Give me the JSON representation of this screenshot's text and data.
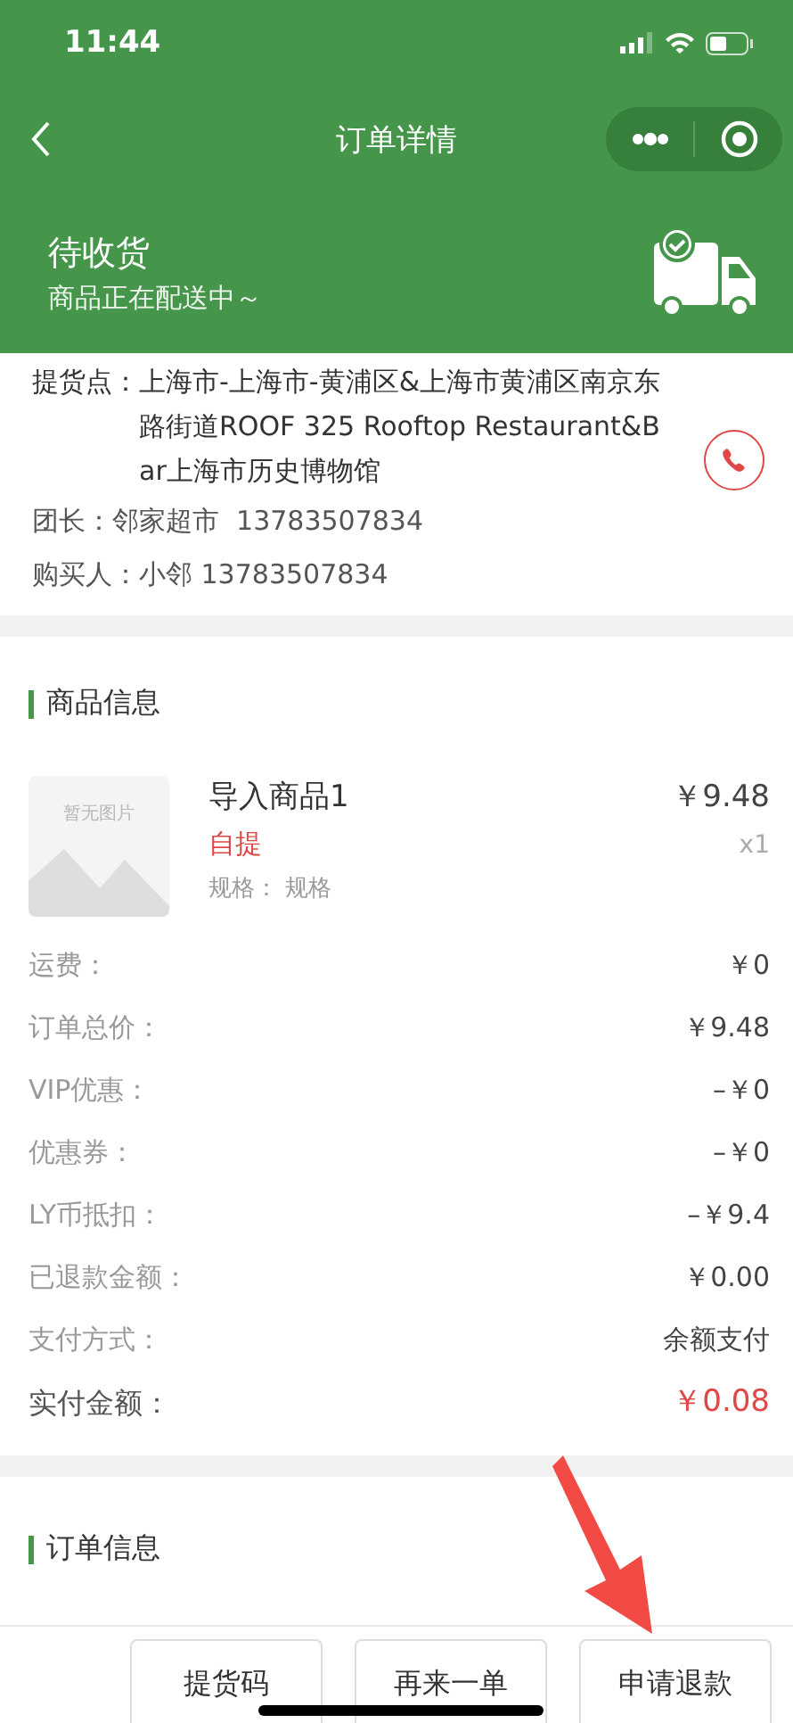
{
  "status_bar": {
    "time": "11:44"
  },
  "nav": {
    "title": "订单详情"
  },
  "order_status": {
    "title": "待收货",
    "subtitle": "商品正在配送中～"
  },
  "pickup": {
    "label": "提货点：",
    "address": "上海市-上海市-黄浦区&上海市黄浦区南京东路街道ROOF 325 Rooftop Restaurant&Bar上海市历史博物馆",
    "leader_label": "团长：",
    "leader": "邻家超市  13783507834",
    "buyer_label": "购买人：",
    "buyer": "小邻 13783507834"
  },
  "goods": {
    "heading": "商品信息",
    "image_placeholder": "暂无图片",
    "name": "导入商品1",
    "price": "￥9.48",
    "tag": "自提",
    "quantity": "x1",
    "spec_label": "规格：",
    "spec": "规格",
    "rows": [
      {
        "label": "运费：",
        "value": "￥0",
        "kind": "normal"
      },
      {
        "label": "订单总价：",
        "value": "￥9.48",
        "kind": "normal"
      },
      {
        "label": "VIP优惠：",
        "value": "–￥0",
        "kind": "normal"
      },
      {
        "label": "优惠券：",
        "value": "–￥0",
        "kind": "normal"
      },
      {
        "label": "LY币抵扣：",
        "value": "–￥9.4",
        "kind": "normal"
      },
      {
        "label": "已退款金额：",
        "value": "￥0.00",
        "kind": "normal"
      },
      {
        "label": "支付方式：",
        "value": "余额支付",
        "kind": "normal"
      },
      {
        "label": "实付金额：",
        "value": "￥0.08",
        "kind": "total"
      }
    ]
  },
  "order_info": {
    "heading": "订单信息"
  },
  "actions": [
    "提货码",
    "再来一单",
    "申请退款"
  ]
}
